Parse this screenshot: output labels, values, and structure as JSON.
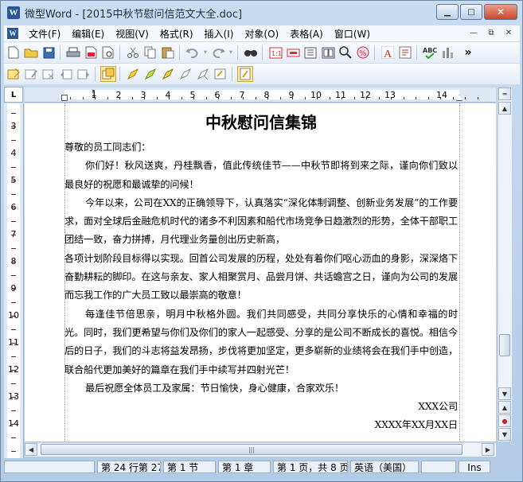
{
  "window": {
    "app_icon_letter": "W",
    "title": "微型Word - [2015中秋节慰问信范文大全.doc]",
    "minimize_glyph": "▁",
    "maximize_glyph": "□",
    "close_glyph": "✕"
  },
  "menubar": {
    "doc_icon_letter": "W",
    "items": [
      "文件(F)",
      "编辑(E)",
      "视图(V)",
      "格式(R)",
      "插入(I)",
      "对象(O)",
      "表格(A)",
      "窗口(W)"
    ],
    "mdi_minimize": "—",
    "mdi_restore": "⧉",
    "mdi_close": "✕"
  },
  "toolbar1": {
    "icons": [
      "new-document-icon",
      "open-folder-icon",
      "save-icon",
      "print-icon",
      "pdf-export-icon",
      "print-preview-icon",
      "cut-icon",
      "copy-icon",
      "paste-icon",
      "undo-icon",
      "redo-icon",
      "find-icon",
      "page-number-icon",
      "insert-field-icon",
      "columns-icon",
      "frame-icon",
      "zoom-icon",
      "percent-icon",
      "font-icon",
      "symbol-icon",
      "spellcheck-icon",
      "chart-icon"
    ],
    "overflow_glyph": "»"
  },
  "toolbar2": {
    "icons": [
      "note-icon",
      "edit-note-icon",
      "delete-note-icon",
      "previous-note-icon",
      "next-note-icon",
      "track-changes-icon",
      "highlight-icon",
      "marker-green-icon",
      "marker-yellow-icon",
      "marker-outline-icon",
      "marker-erase-icon",
      "marker-settings-icon",
      "review-pane-icon"
    ]
  },
  "ruler": {
    "corner_label": "L",
    "h_numbers": [
      "1",
      "1",
      "2",
      "3",
      "4",
      "5",
      "6",
      "7",
      "8",
      "9",
      "10",
      "11",
      "12",
      "13",
      "14"
    ],
    "v_numbers": [
      "3",
      "4",
      "5",
      "6",
      "7",
      "8",
      "9",
      "10",
      "11",
      "12",
      "13",
      "14"
    ]
  },
  "document": {
    "title": "中秋慰问信集锦",
    "paragraphs": [
      {
        "text": "尊敬的员工同志们：",
        "indent": false
      },
      {
        "text": "你们好！秋风送爽，丹桂飘香，值此传统佳节——中秋节即将到来之际，谨向你们致以最良好的祝愿和最诚挚的问候！",
        "indent": true
      },
      {
        "text": "今年以来，公司在XX的正确领导下，认真落实“深化体制调整、创新业务发展”的工作要求，面对全球后金融危机时代的诸多不利因素和船代市场竞争日趋激烈的形势，全体干部职工团结一致，奋力拼搏，月代理业务量创出历史新高，",
        "indent": true
      },
      {
        "text": "各项计划阶段目标得以实现。回首公司发展的历程，处处有着你们呕心沥血的身影，深深烙下奋勤耕耘的脚印。在这与亲友、家人相聚赏月、品尝月饼、共话蟾宫之日，谨向为公司的发展而忘我工作的广大员工致以最崇高的敬意！",
        "indent": false
      },
      {
        "text": "每逢佳节倍思亲，明月中秋格外圆。我们共同感受，共同分享快乐的心情和幸福的时光。同时，我们更希望与你们及你们的家人一起感受、分享的是公司不断成长的喜悦。相信今后的日子，我们的斗志将益发昂扬，步伐将更加坚定，更多崭新的业绩将会在我们手中创造，联合船代更加美好的篇章在我们手中续写并四射光芒！",
        "indent": true
      },
      {
        "text": "最后祝愿全体员工及家属：节日愉快，身心健康，合家欢乐！",
        "indent": true
      }
    ],
    "signature": "XXX公司",
    "date": "XXXX年XX月XX日"
  },
  "scrollbar": {
    "up_glyph": "▲",
    "down_glyph": "▼",
    "split_glyph": "═",
    "prev_page_glyph": "▲",
    "select_browse_glyph": "●",
    "next_page_glyph": "▼",
    "left_glyph": "◀",
    "right_glyph": "▶",
    "thumb_grip": "|||"
  },
  "statusbar": {
    "cells": [
      "",
      "第 24 行第 27",
      "第 1 节",
      "第 1 章",
      "第 1 页，共 8 页",
      "英语（美国）",
      "",
      "Ins"
    ]
  }
}
